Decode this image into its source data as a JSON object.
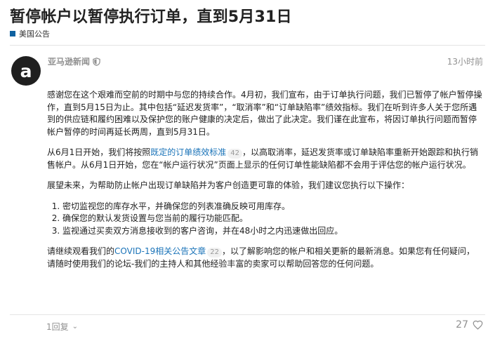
{
  "page_title": "暂停帐户以暂停执行订单，直到5月31日",
  "category": {
    "label": "美国公告",
    "color": "#0f61a0"
  },
  "post": {
    "author": "亚马逊新闻",
    "avatar_letter": "a",
    "time_ago": "13小时前",
    "paragraphs": {
      "p1": "感谢您在这个艰难而空前的时期中与您的持续合作。4月初，我们宣布，由于订单执行问题，我们已暂停了帐户暂停操作，直到5月15日为止。其中包括“延迟发货率”，“取消率”和“订单缺陷率”绩效指标。我们在听到许多人关于您所遇到的供应链和履约困难以及保护您的账户健康的决定后，做出了此决定。我们谨在此宣布，将因订单执行问题而暂停帐户暂停的时间再延长两周，直到5月31日。",
      "p2_before": "从6月1日开始，我们将按照",
      "p2_link": "既定的订单绩效标准",
      "p2_badge": "42",
      "p2_after": "，以高取消率，延迟发货率或订单缺陷率重新开始跟踪和执行销售帐户。从6月1日开始，您在“帐户运行状况”页面上显示的任何订单性能缺陷都不会用于评估您的帐户运行状况。",
      "p3": "展望未来，为帮助防止帐户出现订单缺陷并为客户创造更可靠的体验，我们建议您执行以下操作：",
      "p4_before": "请继续观看我们的",
      "p4_link": "COVID-19相关公告文章",
      "p4_badge": "22",
      "p4_after": "，以了解影响您的帐户和相关更新的最新消息。如果您有任何疑问，请随时使用我们的论坛-我们的主持人和其他经验丰富的卖家可以帮助回答您的任何问题。"
    },
    "list": [
      "密切监视您的库存水平，并确保您的列表准确反映可用库存。",
      "确保您的默认发货设置与您当前的履行功能匹配。",
      "监视通过买卖双方消息接收到的客户咨询，并在48小时之内迅速做出回应。"
    ]
  },
  "footer": {
    "reply_count": "1回复",
    "like_count": "27"
  }
}
